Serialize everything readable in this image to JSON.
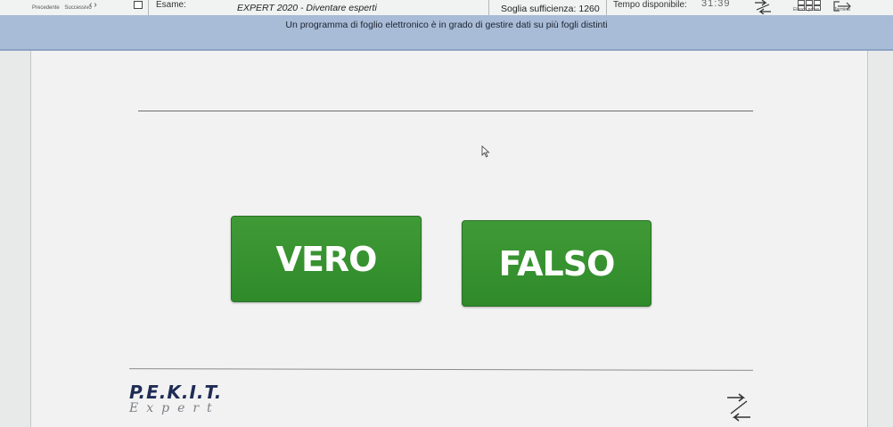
{
  "toolbar": {
    "prev_label": "Precedente",
    "next_label": "Successivo",
    "exam_label": "Esame:",
    "exam_name": "EXPERT 2020 - Diventare esperti",
    "threshold": "Soglia sufficienza: 1260",
    "time_label": "Tempo disponibile:",
    "time_value": "31:39",
    "list_label": "Elenco prove",
    "end_label": "Termina"
  },
  "question": {
    "text": "Un programma di foglio elettronico è in grado di gestire dati su più fogli distinti"
  },
  "answers": {
    "true_label": "VERO",
    "false_label": "FALSO"
  },
  "brand": {
    "logo_main": "P.E.K.I.T.",
    "logo_sub": "Expert"
  },
  "colors": {
    "question_band": "#a8bcd7",
    "answer_button": "#3a9332",
    "logo": "#1f2c55"
  },
  "icons": [
    "chevron-left-icon",
    "chevron-right-icon",
    "flag-checkbox",
    "swap-arrows-icon",
    "grid-icon",
    "exit-icon",
    "mouse-cursor-icon"
  ]
}
